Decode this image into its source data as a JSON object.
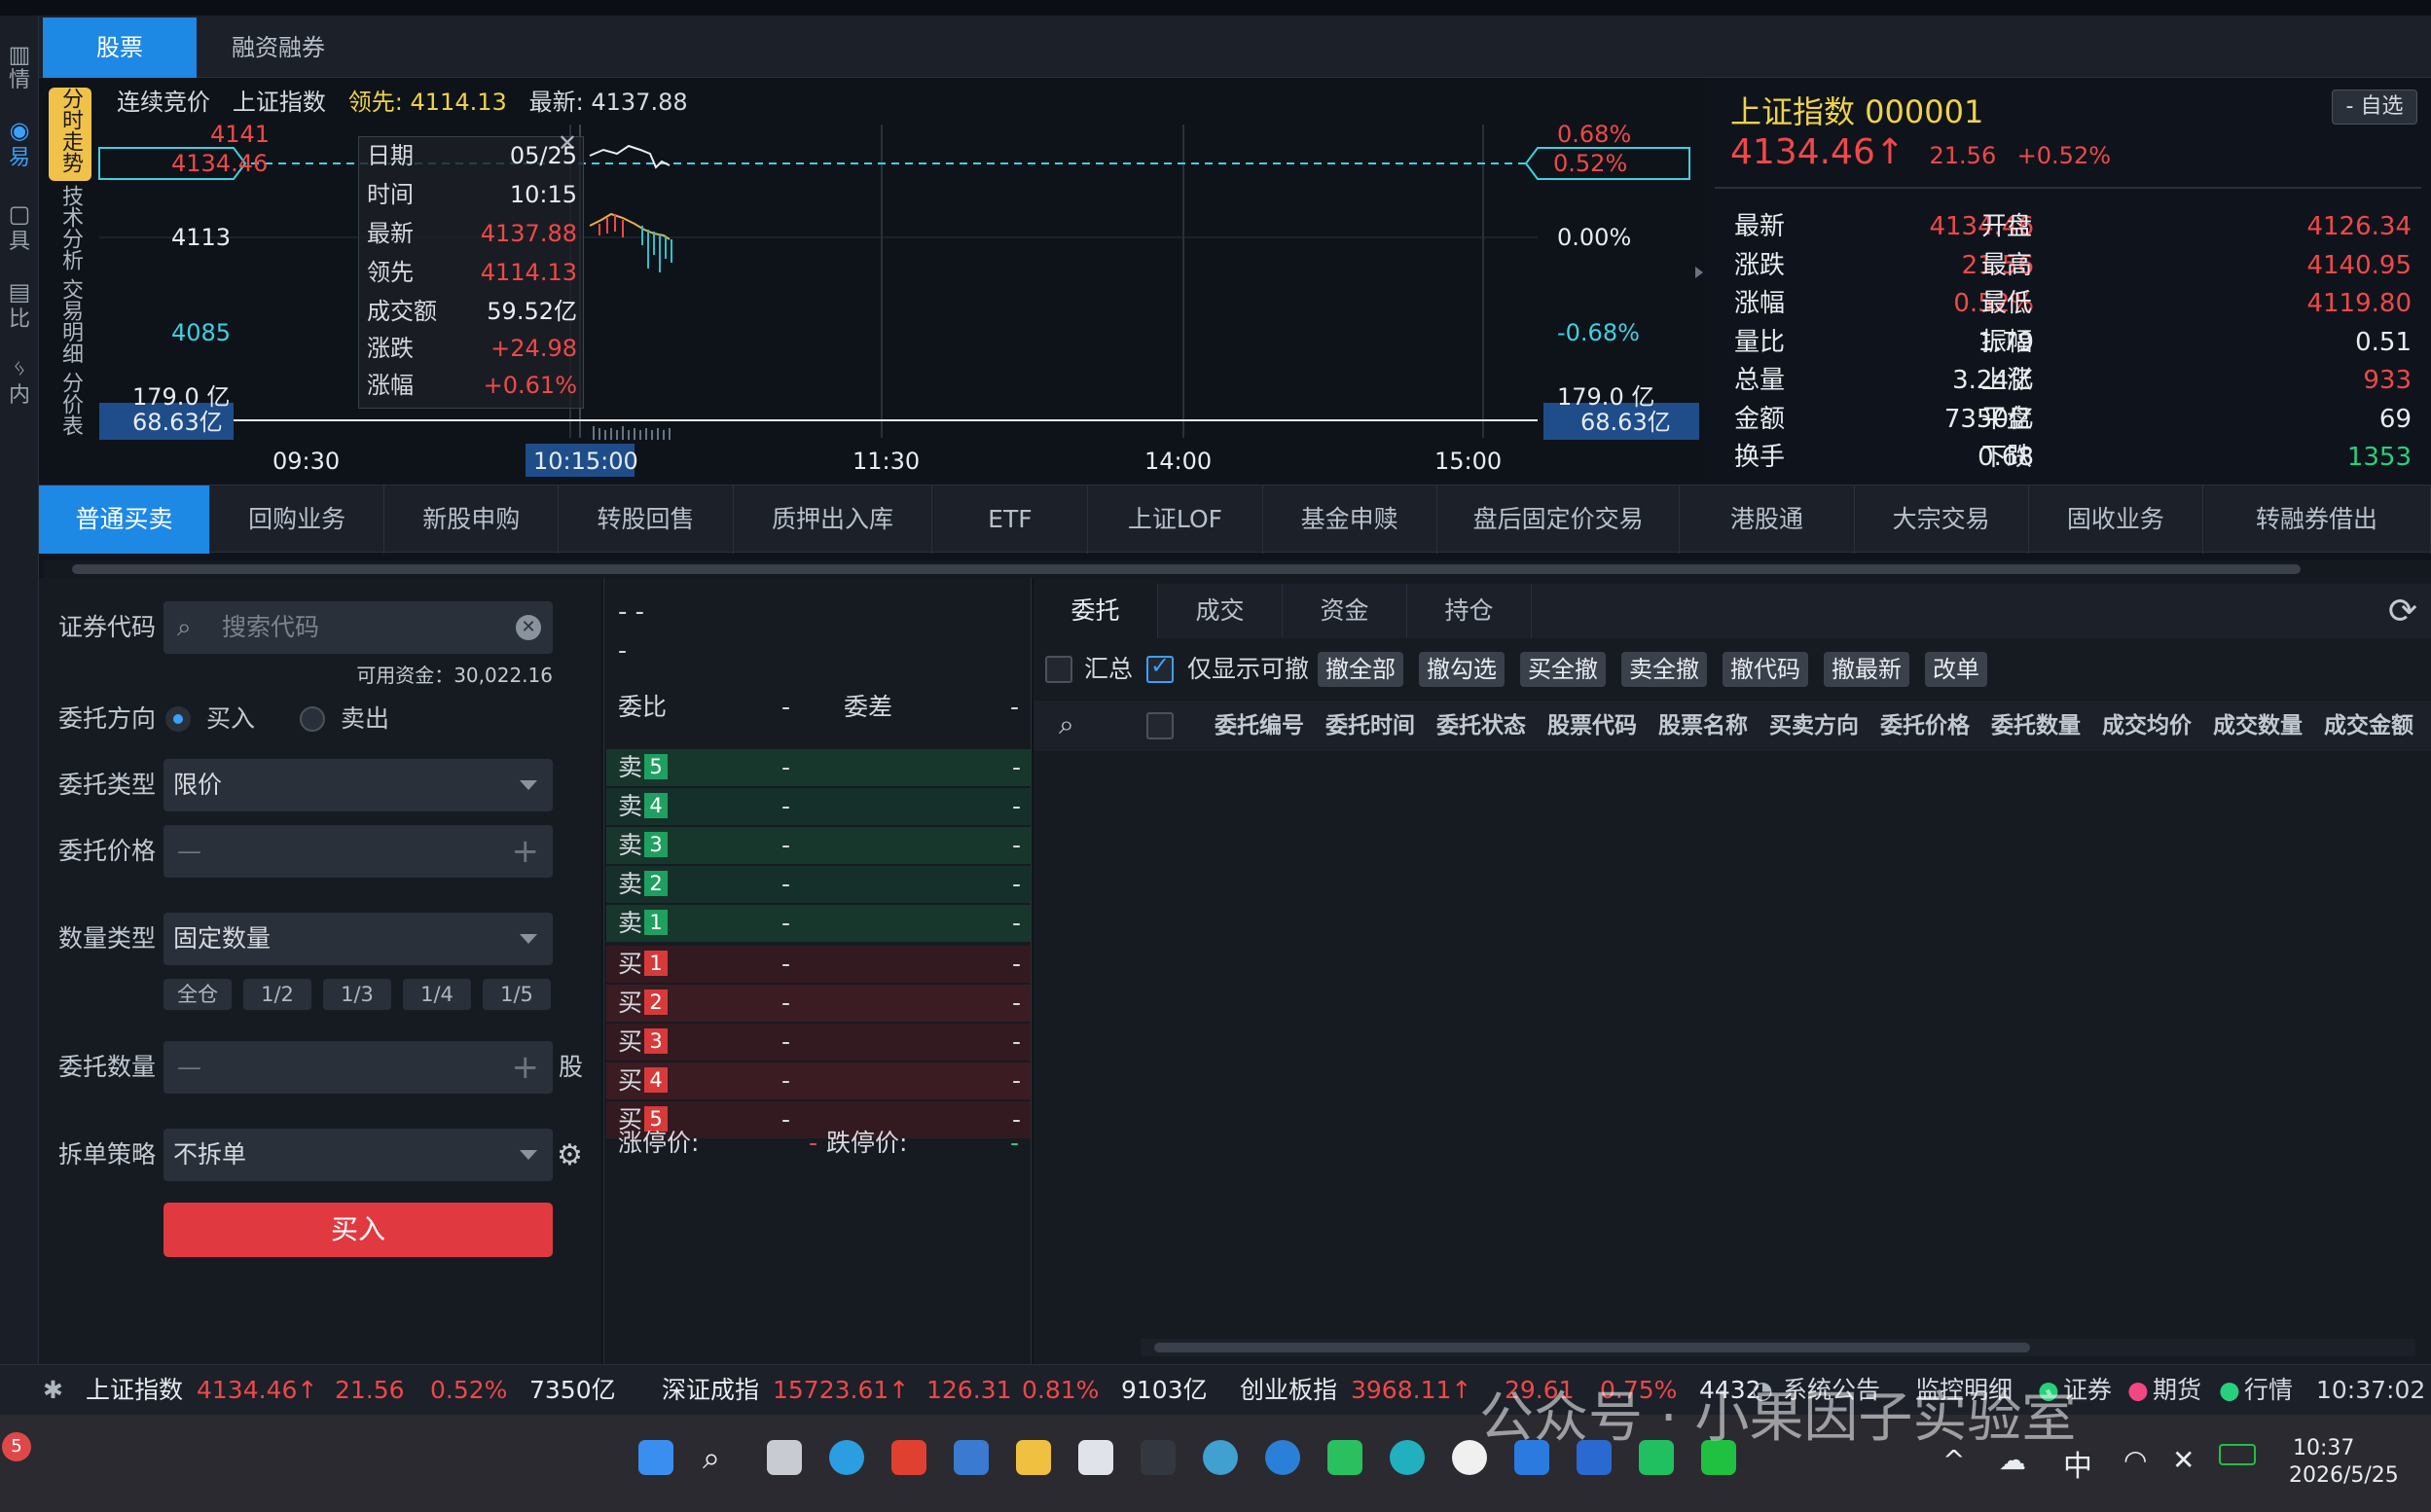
{
  "top_tabs": [
    "股票",
    "融资融券"
  ],
  "rail": [
    "情",
    "易",
    "具",
    "比",
    "内"
  ],
  "chart": {
    "side_tabs": [
      "分时走势",
      "技术分析",
      "交易明细",
      "分价表"
    ],
    "info": {
      "mode": "连续竞价",
      "name": "上证指数",
      "lead_label": "领先",
      "lead_value": "4114.13",
      "latest_label": "最新",
      "latest_value": "4137.88"
    },
    "y_labels_left": [
      "4141",
      "4113",
      "4085",
      "179.0 亿"
    ],
    "y_labels_right": [
      "0.68%",
      "0.00%",
      "-0.68%",
      "179.0 亿"
    ],
    "cursor_price": "4134.46",
    "cursor_pct": "0.52%",
    "cursor_vol_left": "68.63亿",
    "cursor_vol_right": "68.63亿",
    "x_labels": [
      "09:30",
      "11:30",
      "14:00",
      "15:00"
    ],
    "cursor_time": "10:15:00",
    "tooltip": [
      {
        "k": "日期",
        "v": "05/25"
      },
      {
        "k": "时间",
        "v": "10:15"
      },
      {
        "k": "最新",
        "v": "4137.88"
      },
      {
        "k": "领先",
        "v": "4114.13"
      },
      {
        "k": "成交额",
        "v": "59.52亿"
      },
      {
        "k": "涨跌",
        "v": "+24.98"
      },
      {
        "k": "涨幅",
        "v": "+0.61%"
      }
    ],
    "close_glyph": "✕"
  },
  "quote": {
    "title": "上证指数 000001",
    "fav_button": "- 自选",
    "price": "4134.46",
    "arrow": "↑",
    "change": "21.56",
    "pct": "+0.52%",
    "rows": [
      [
        "最新",
        "4134.46",
        "开盘",
        "4126.34"
      ],
      [
        "涨跌",
        "21.56",
        "最高",
        "4140.95"
      ],
      [
        "涨幅",
        "0.52%",
        "最低",
        "4119.80"
      ],
      [
        "量比",
        "1.79",
        "振幅",
        "0.51"
      ],
      [
        "总量",
        "3.24亿",
        "上涨",
        "933"
      ],
      [
        "金额",
        "7350亿",
        "平盘",
        "69"
      ],
      [
        "换手",
        "0.68",
        "下跌",
        "1353"
      ]
    ]
  },
  "biz_tabs": [
    "普通买卖",
    "回购业务",
    "新股申购",
    "转股回售",
    "质押出入库",
    "ETF",
    "上证LOF",
    "基金申赎",
    "盘后固定价交易",
    "港股通",
    "大宗交易",
    "固收业务",
    "转融券借出"
  ],
  "form": {
    "code_label": "证券代码",
    "search_placeholder": "搜索代码",
    "available": "可用资金：30,022.16",
    "dir_label": "委托方向",
    "buy_opt": "买入",
    "sell_opt": "卖出",
    "type_label": "委托类型",
    "type_value": "限价",
    "price_label": "委托价格",
    "minus": "—",
    "plus": "+",
    "qty_type_label": "数量类型",
    "qty_type_value": "固定数量",
    "quick": [
      "全仓",
      "1/2",
      "1/3",
      "1/4",
      "1/5"
    ],
    "qty_label": "委托数量",
    "unit": "股",
    "split_label": "拆单策略",
    "split_value": "不拆单",
    "submit": "买入"
  },
  "book": {
    "dash1": "- -",
    "dash2": "-",
    "ratio_label": "委比",
    "ratio_val": "-",
    "diff_label": "委差",
    "diff_val": "-",
    "sells": [
      {
        "l": "卖",
        "n": "5"
      },
      {
        "l": "卖",
        "n": "4"
      },
      {
        "l": "卖",
        "n": "3"
      },
      {
        "l": "卖",
        "n": "2"
      },
      {
        "l": "卖",
        "n": "1"
      }
    ],
    "buys": [
      {
        "l": "买",
        "n": "1"
      },
      {
        "l": "买",
        "n": "2"
      },
      {
        "l": "买",
        "n": "3"
      },
      {
        "l": "买",
        "n": "4"
      },
      {
        "l": "买",
        "n": "5"
      }
    ],
    "dash": "-",
    "limit_up_label": "涨停价:",
    "limit_up": "-",
    "limit_down_label": "跌停价:",
    "limit_down": "-"
  },
  "orders": {
    "tabs": [
      "委托",
      "成交",
      "资金",
      "持仓"
    ],
    "summary_label": "汇总",
    "only_cancelable": "仅显示可撤",
    "actions": [
      "撤全部",
      "撤勾选",
      "买全撤",
      "卖全撤",
      "撤代码",
      "撤最新",
      "改单"
    ],
    "columns": [
      "委托编号",
      "委托时间",
      "委托状态",
      "股票代码",
      "股票名称",
      "买卖方向",
      "委托价格",
      "委托数量",
      "成交均价",
      "成交数量",
      "成交金额"
    ]
  },
  "status": {
    "items": [
      {
        "name": "上证指数",
        "price": "4134.46↑",
        "chg": "21.56",
        "pct": "0.52%",
        "amt": "7350亿"
      },
      {
        "name": "深证成指",
        "price": "15723.61↑",
        "chg": "126.31",
        "pct": "0.81%",
        "amt": "9103亿"
      },
      {
        "name": "创业板指",
        "price": "3968.11↑",
        "chg": "29.61",
        "pct": "0.75%",
        "amt": "4432"
      }
    ],
    "notice": "系统公告",
    "monitor": "监控明细",
    "links": [
      "证券",
      "期货",
      "行情"
    ],
    "clock": "10:37:02"
  },
  "taskbar": {
    "badge": "5",
    "ime": "中",
    "time": "10:37",
    "date": "2026/5/25"
  },
  "watermark": "公众号 · 小果因子实验室"
}
